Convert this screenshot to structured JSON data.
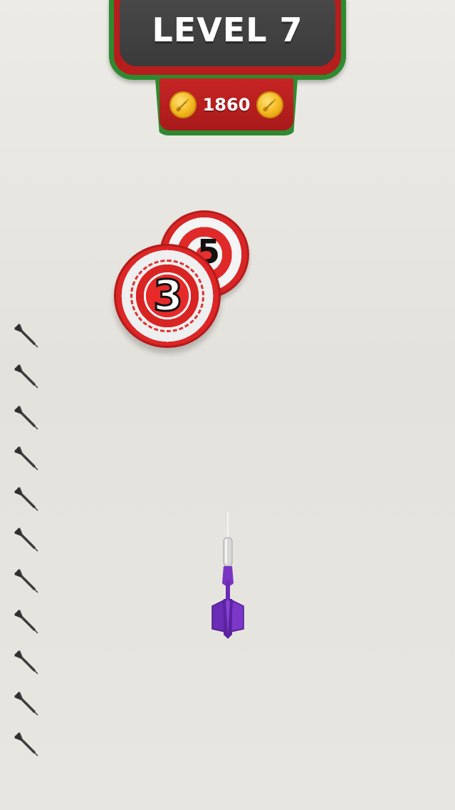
{
  "hud": {
    "level_label": "LEVEL 7",
    "coins": "1860"
  },
  "targets": [
    {
      "number": "5"
    },
    {
      "number": "3"
    }
  ],
  "remaining_darts": 11,
  "colors": {
    "background": "#e7e6e1",
    "banner_dark": "#3f3f3f",
    "banner_red": "#b61d1d",
    "banner_green": "#2f8a2f",
    "coin_gold": "#f4b81e",
    "target_red": "#dd2626",
    "dart_purple": "#6a2bb5"
  },
  "icons": {
    "coin": "coin-dart-icon",
    "dart": "dart-icon"
  }
}
